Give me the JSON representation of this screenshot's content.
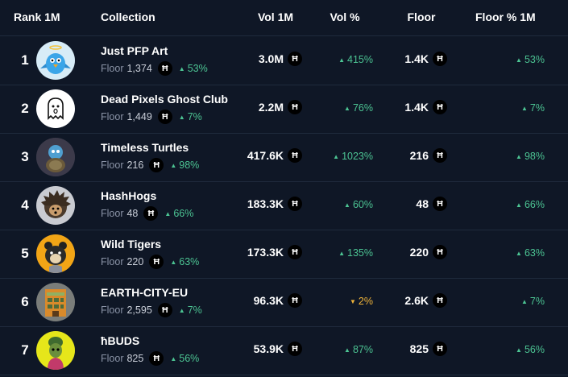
{
  "columns": {
    "rank": "Rank 1M",
    "collection": "Collection",
    "vol": "Vol 1M",
    "vol_pct": "Vol %",
    "floor": "Floor",
    "floor_pct": "Floor % 1M"
  },
  "currency_symbol": "Ħ",
  "floor_label": "Floor",
  "colors": {
    "positive": "#4cc493",
    "negative": "#f0b43a",
    "background": "#0f1726"
  },
  "rows": [
    {
      "rank": "1",
      "name": "Just PFP Art",
      "floor_price": "1,374",
      "floor_change": "53%",
      "floor_change_dir": "up",
      "vol": "3.0M",
      "vol_pct": "415%",
      "vol_pct_dir": "up",
      "floor": "1.4K",
      "floor_pct": "53%",
      "floor_pct_dir": "up",
      "avatar_icon": "blue-bird-avatar"
    },
    {
      "rank": "2",
      "name": "Dead Pixels Ghost Club",
      "floor_price": "1,449",
      "floor_change": "7%",
      "floor_change_dir": "up",
      "vol": "2.2M",
      "vol_pct": "76%",
      "vol_pct_dir": "up",
      "floor": "1.4K",
      "floor_pct": "7%",
      "floor_pct_dir": "up",
      "avatar_icon": "ghost-avatar"
    },
    {
      "rank": "3",
      "name": "Timeless Turtles",
      "floor_price": "216",
      "floor_change": "98%",
      "floor_change_dir": "up",
      "vol": "417.6K",
      "vol_pct": "1023%",
      "vol_pct_dir": "up",
      "floor": "216",
      "floor_pct": "98%",
      "floor_pct_dir": "up",
      "avatar_icon": "turtle-avatar"
    },
    {
      "rank": "4",
      "name": "HashHogs",
      "floor_price": "48",
      "floor_change": "66%",
      "floor_change_dir": "up",
      "vol": "183.3K",
      "vol_pct": "60%",
      "vol_pct_dir": "up",
      "floor": "48",
      "floor_pct": "66%",
      "floor_pct_dir": "up",
      "avatar_icon": "hedgehog-avatar"
    },
    {
      "rank": "5",
      "name": "Wild Tigers",
      "floor_price": "220",
      "floor_change": "63%",
      "floor_change_dir": "up",
      "vol": "173.3K",
      "vol_pct": "135%",
      "vol_pct_dir": "up",
      "floor": "220",
      "floor_pct": "63%",
      "floor_pct_dir": "up",
      "avatar_icon": "tiger-avatar"
    },
    {
      "rank": "6",
      "name": "EARTH-CITY-EU",
      "floor_price": "2,595",
      "floor_change": "7%",
      "floor_change_dir": "up",
      "vol": "96.3K",
      "vol_pct": "2%",
      "vol_pct_dir": "down",
      "floor": "2.6K",
      "floor_pct": "7%",
      "floor_pct_dir": "up",
      "avatar_icon": "building-avatar"
    },
    {
      "rank": "7",
      "name": "ħBUDS",
      "floor_price": "825",
      "floor_change": "56%",
      "floor_change_dir": "up",
      "vol": "53.9K",
      "vol_pct": "87%",
      "vol_pct_dir": "up",
      "floor": "825",
      "floor_pct": "56%",
      "floor_pct_dir": "up",
      "avatar_icon": "bud-avatar"
    }
  ]
}
